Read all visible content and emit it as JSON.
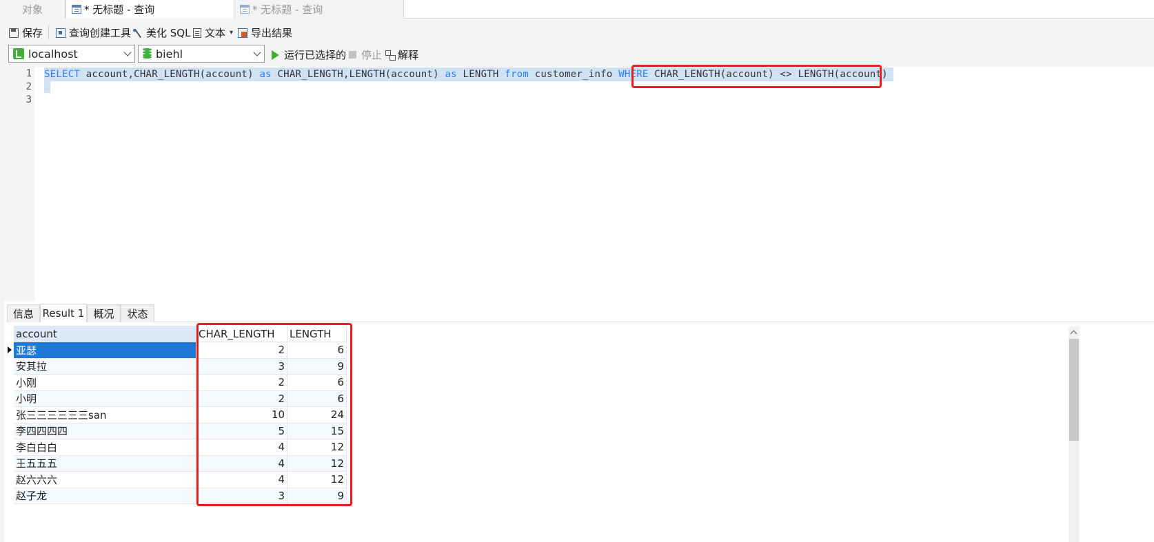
{
  "tabs": {
    "objects_label": "对象",
    "query1_label": "* 无标题 - 查询",
    "query2_label": "* 无标题 - 查询"
  },
  "toolbar": {
    "save": "保存",
    "query_builder": "查询创建工具",
    "beautify": "美化 SQL",
    "text": "文本",
    "export": "导出结果",
    "connection": "localhost",
    "database": "biehl",
    "run_selected": "运行已选择的",
    "stop": "停止",
    "explain": "解释"
  },
  "editor": {
    "line_numbers": [
      "1",
      "2",
      "3"
    ],
    "tokens": [
      {
        "t": "SELECT",
        "k": "kw"
      },
      {
        "t": " account,CHAR_LENGTH(account) ",
        "k": "tx"
      },
      {
        "t": "as",
        "k": "kw"
      },
      {
        "t": " CHAR_LENGTH,LENGTH(account) ",
        "k": "tx"
      },
      {
        "t": "as",
        "k": "kw"
      },
      {
        "t": " LENGTH ",
        "k": "tx"
      },
      {
        "t": "from",
        "k": "kw"
      },
      {
        "t": " customer_info ",
        "k": "tx"
      },
      {
        "t": "WHERE",
        "k": "kw"
      },
      {
        "t": " CHAR_LENGTH(account) <> LENGTH(account) ",
        "k": "tx"
      }
    ]
  },
  "result_tabs": [
    "信息",
    "Result 1",
    "概况",
    "状态"
  ],
  "result": {
    "columns": [
      "account",
      "CHAR_LENGTH",
      "LENGTH"
    ],
    "rows": [
      [
        "亚瑟",
        "2",
        "6"
      ],
      [
        "安其拉",
        "3",
        "9"
      ],
      [
        "小刚",
        "2",
        "6"
      ],
      [
        "小明",
        "2",
        "6"
      ],
      [
        "张三三三三三三san",
        "10",
        "24"
      ],
      [
        "李四四四四",
        "5",
        "15"
      ],
      [
        "李白白白",
        "4",
        "12"
      ],
      [
        "王五五五",
        "4",
        "12"
      ],
      [
        "赵六六六",
        "4",
        "12"
      ],
      [
        "赵子龙",
        "3",
        "9"
      ]
    ]
  },
  "colors": {
    "keyword": "#2a7fff",
    "selection": "#cfe1f3",
    "annotation": "#e8201c",
    "selected_row": "#1e78d7"
  }
}
